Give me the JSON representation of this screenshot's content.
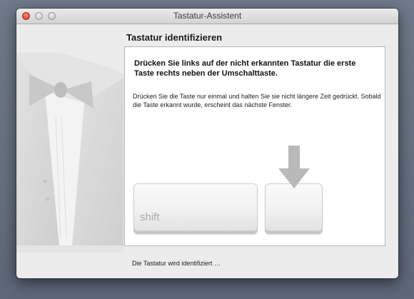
{
  "window": {
    "title": "Tastatur-Assistent"
  },
  "heading": "Tastatur identifizieren",
  "instruction": "Drücken Sie links auf der nicht erkannten Tastatur die erste Taste rechts neben der Umschalttaste.",
  "detail": "Drücken Sie die Taste nur einmal und halten Sie sie nicht längere Zeit gedrückt. Sobald die Taste erkannt wurde, erscheint das nächste Fenster.",
  "keys": {
    "shift_label": "shift"
  },
  "status": "Die Tastatur wird identifiziert …",
  "colors": {
    "close": "#d9453a",
    "arrow": "#b9b9b9",
    "panel": "#ffffff"
  },
  "icons": {
    "arrow": "down-arrow-icon",
    "sidebar": "tuxedo-icon"
  }
}
